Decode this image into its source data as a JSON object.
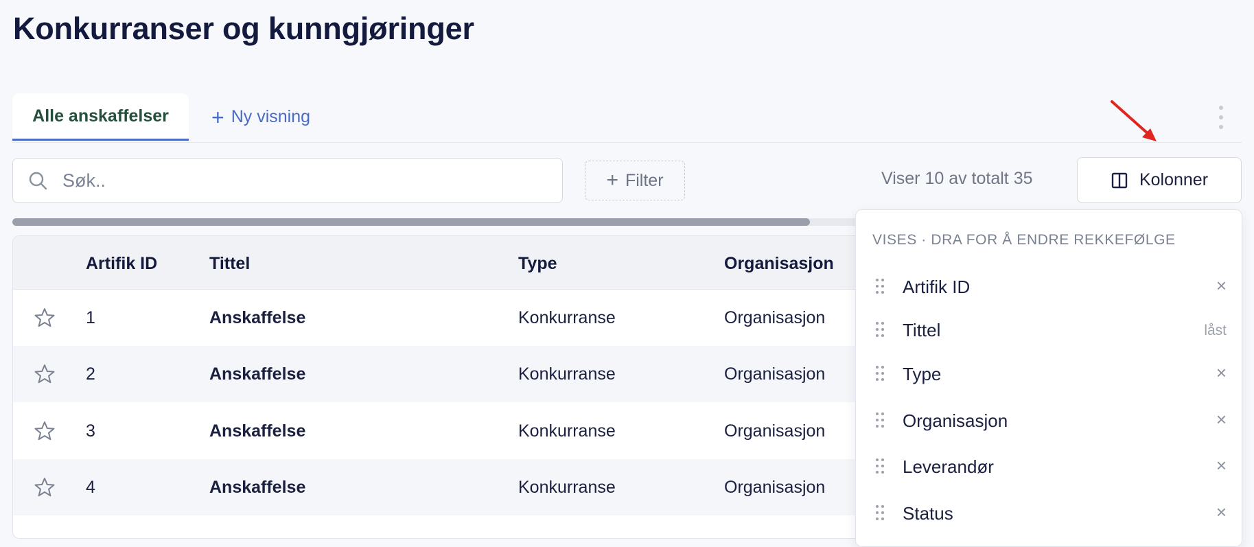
{
  "page": {
    "title": "Konkurranser og kunngjøringer"
  },
  "tabs": {
    "active_label": "Alle anskaffelser",
    "new_view_label": "Ny visning"
  },
  "toolbar": {
    "search_placeholder": "Søk..",
    "filter_label": "Filter",
    "count_text": "Viser 10 av totalt 35",
    "columns_label": "Kolonner"
  },
  "table": {
    "headers": {
      "id": "Artifik ID",
      "title": "Tittel",
      "type": "Type",
      "org": "Organisasjon"
    },
    "rows": [
      {
        "id": "1",
        "title": "Anskaffelse",
        "type": "Konkurranse",
        "org": "Organisasjon"
      },
      {
        "id": "2",
        "title": "Anskaffelse",
        "type": "Konkurranse",
        "org": "Organisasjon"
      },
      {
        "id": "3",
        "title": "Anskaffelse",
        "type": "Konkurranse",
        "org": "Organisasjon"
      },
      {
        "id": "4",
        "title": "Anskaffelse",
        "type": "Konkurranse",
        "org": "Organisasjon"
      }
    ]
  },
  "columns_panel": {
    "heading": "VISES · DRA FOR Å ENDRE REKKEFØLGE",
    "items": [
      {
        "label": "Artifik ID",
        "action": "×"
      },
      {
        "label": "Tittel",
        "locked": "låst"
      },
      {
        "label": "Type",
        "action": "×"
      },
      {
        "label": "Organisasjon",
        "action": "×"
      },
      {
        "label": "Leverandør",
        "action": "×"
      },
      {
        "label": "Status",
        "action": "×"
      }
    ]
  },
  "colors": {
    "accent": "#4a6bc5",
    "active_tab_text": "#244f3a",
    "annotation_arrow": "#e0261f",
    "title": "#141a3d"
  }
}
